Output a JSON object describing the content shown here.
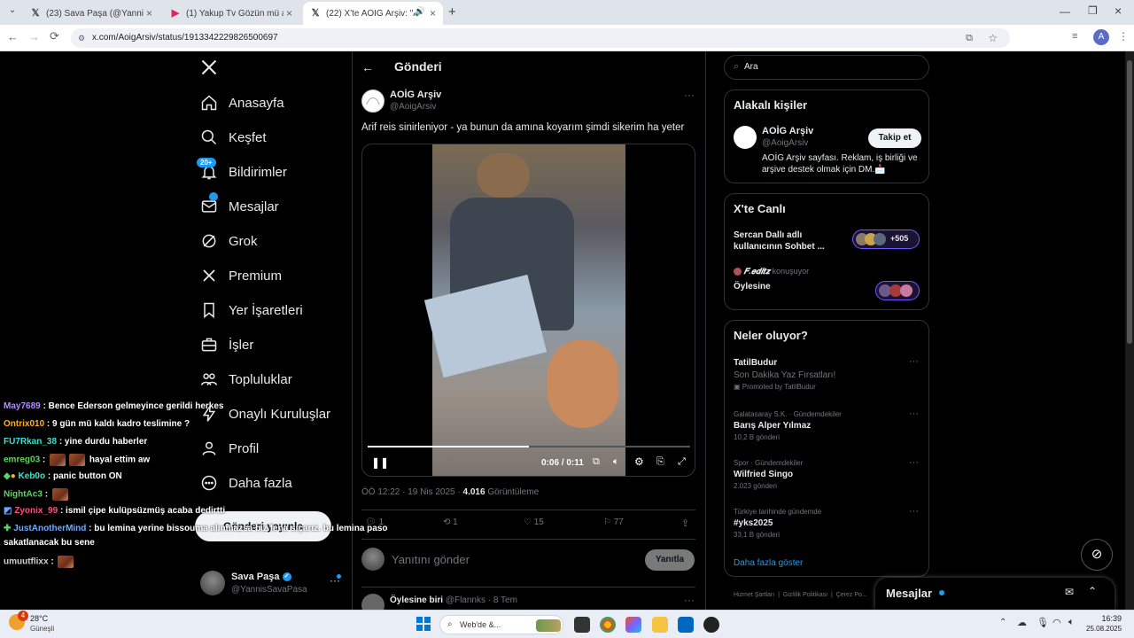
{
  "browser": {
    "tabs": [
      {
        "title": "(23) Sava Paşa (@YannisSavaPa...",
        "icon": "x-logo"
      },
      {
        "title": "(1) Yakup Tv Gözün mü açıldı - ...",
        "icon": "youtube-logo"
      },
      {
        "title": "(22) X'te AOİG Arşiv: \"Arif re...",
        "icon": "x-logo"
      }
    ],
    "url": "x.com/AoigArsiv/status/1913342229826500697",
    "profile_letter": "A"
  },
  "nav": {
    "items": [
      {
        "label": "Anasayfa",
        "icon": "home-icon"
      },
      {
        "label": "Keşfet",
        "icon": "search-icon"
      },
      {
        "label": "Bildirimler",
        "icon": "bell-icon",
        "badge": "20+"
      },
      {
        "label": "Mesajlar",
        "icon": "mail-icon"
      },
      {
        "label": "Grok",
        "icon": "grok-icon"
      },
      {
        "label": "Premium",
        "icon": "x-logo-icon"
      },
      {
        "label": "Yer İşaretleri",
        "icon": "bookmark-icon"
      },
      {
        "label": "İşler",
        "icon": "briefcase-icon"
      },
      {
        "label": "Topluluklar",
        "icon": "communities-icon"
      },
      {
        "label": "Onaylı Kuruluşlar",
        "icon": "lightning-icon"
      },
      {
        "label": "Profil",
        "icon": "profile-icon"
      },
      {
        "label": "Daha fazla",
        "icon": "more-circle-icon"
      }
    ],
    "post_button": "Gönderi yayınla",
    "account": {
      "name": "Sava Paşa",
      "handle": "@YannisSavaPasa"
    }
  },
  "post": {
    "header": "Gönderi",
    "author": "AOİG Arşiv",
    "handle": "@AoigArsiv",
    "text": "Arif reis sinirleniyor - ya bunun da amına koyarım şimdi sikerim ha yeter",
    "video_time": "0:06 / 0:11",
    "video_progress": 0.5,
    "meta_time": "ÖÖ 12:22 · 19 Nis 2025 · ",
    "views": "4.016",
    "views_label": "Görüntüleme",
    "stats": {
      "replies": "1",
      "reposts": "1",
      "likes": "15",
      "bookmarks": "77"
    },
    "reply_placeholder": "Yanıtını gönder",
    "reply_button": "Yanıtla",
    "next_reply": {
      "author": "Öylesine biri",
      "handle": "@Flannks",
      "time": "· 8 Tem"
    }
  },
  "right": {
    "search_placeholder": "Ara",
    "relevant": {
      "title": "Alakalı kişiler",
      "name": "AOİG Arşiv",
      "handle": "@AoigArsiv",
      "follow": "Takip et",
      "bio": "AOİG Arşiv sayfası. Reklam, iş birliği ve arşive destek olmak için DM.📩"
    },
    "live": {
      "title": "X'te Canlı",
      "item1": "Sercan Dallı adlı kullanıcının Sohbet ...",
      "item1_count": "+505",
      "item2_user": "𝑭.𝒆𝒅𝒊𝒕𝒛",
      "item2_status": "konuşuyor",
      "item2_title": "Öylesine"
    },
    "trends": {
      "title": "Neler oluyor?",
      "items": [
        {
          "context": "",
          "name": "TatilBudur",
          "sub": "Son Dakika Yaz Fırsatları!",
          "promoted": "Promoted by TatilBudur"
        },
        {
          "context": "Galatasaray S.K. · Gündemdekiler",
          "name": "Barış Alper Yılmaz",
          "count": "10,2 B gönderi"
        },
        {
          "context": "Spor · Gündemdekiler",
          "name": "Wilfried Singo",
          "count": "2.023 gönderi"
        },
        {
          "context": "Türkiye tarihinde gündemde",
          "name": "#yks2025",
          "count": "33,1 B gönderi"
        }
      ],
      "more": "Daha fazla göster"
    },
    "footer_links": [
      "Hizmet Şartları",
      "Gizlilik Politikası",
      "Çerez Po..."
    ],
    "messages_title": "Mesajlar"
  },
  "chat": [
    {
      "user": "May7689",
      "color": "#b58cff",
      "msg": ": Bence Ederson gelmeyince gerildi herkes"
    },
    {
      "user": "Ontrix010",
      "color": "#ffb020",
      "msg": ": 9 gün mü kaldı kadro teslimine ?"
    },
    {
      "user": "FU7Rkan_38",
      "color": "#3de0d0",
      "msg": ": yine durdu haberler"
    },
    {
      "user": "emreg03",
      "color": "#5fd35f",
      "msg": "hayal ettim aw"
    },
    {
      "user": "Keb0o",
      "color": "#3de0d0",
      "msg": ": panic button ON"
    },
    {
      "user": "NightAc3",
      "color": "#5fd35f",
      "msg": ":"
    },
    {
      "user": "Zyonix_99",
      "color": "#ff4f7a",
      "msg": ": ismil çipe kulüpsüzmüş acaba dedirtti"
    },
    {
      "user": "JustAnotherMind",
      "color": "#6fa8ff",
      "msg": ": bu lemina yerine bissouma alınmazsa biz fena sıçarız. bu lemina paso"
    },
    {
      "user": "",
      "color": "#fff",
      "msg": "sakatlanacak bu sene"
    },
    {
      "user": "umuutflixx",
      "color": "#cfcfcf",
      "msg": ":"
    }
  ],
  "taskbar": {
    "weather_temp": "28°C",
    "weather_desc": "Güneşli",
    "search": "Web'de &...",
    "time": "16:39",
    "date": "25.08.2025",
    "notif_badge": "4"
  }
}
